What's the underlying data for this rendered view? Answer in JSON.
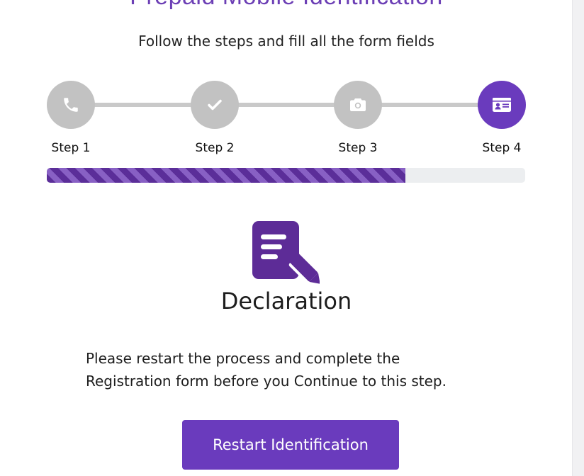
{
  "page": {
    "title": "Prepaid Mobile Identification",
    "subtitle": "Follow the steps and fill all the form fields"
  },
  "steps": [
    {
      "label": "Step 1",
      "icon": "phone-icon",
      "state": "done"
    },
    {
      "label": "Step 2",
      "icon": "check-icon",
      "state": "done"
    },
    {
      "label": "Step 3",
      "icon": "camera-icon",
      "state": "done"
    },
    {
      "label": "Step 4",
      "icon": "id-card-icon",
      "state": "active"
    }
  ],
  "progress": {
    "fraction": 0.75
  },
  "declaration": {
    "icon": "document-edit-icon",
    "title": "Declaration",
    "message_line1": "Please restart the process and complete the",
    "message_line2": "Registration form before you Continue to this step."
  },
  "actions": {
    "restart_label": "Restart Identification"
  },
  "colors": {
    "accent": "#6a3bbd",
    "inactive_step": "#c2c2c2",
    "progress_track": "#eceef0"
  }
}
